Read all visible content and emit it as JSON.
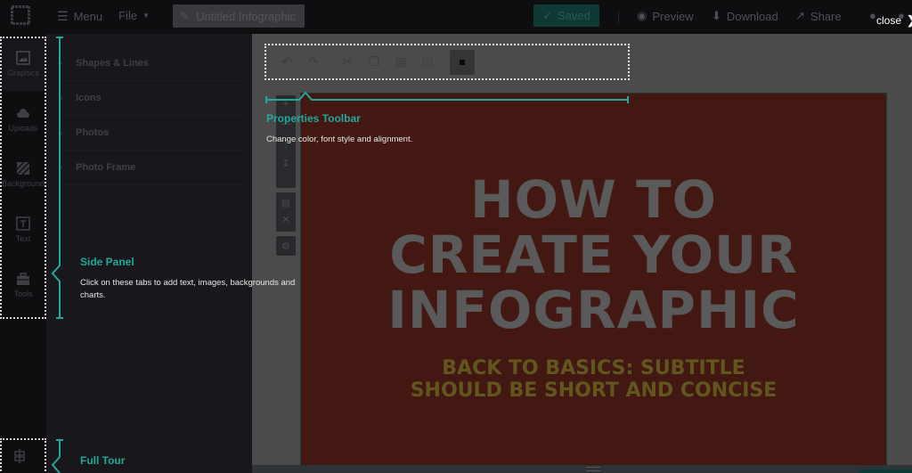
{
  "topbar": {
    "menu_label": "Menu",
    "file_label": "File",
    "document_title": "Untitled Infographic",
    "saved_label": "Saved",
    "preview_label": "Preview",
    "download_label": "Download",
    "share_label": "Share",
    "close_label": "close"
  },
  "rail": {
    "items": [
      {
        "label": "Graphics",
        "icon": "image-icon",
        "active": true
      },
      {
        "label": "Uploads",
        "icon": "cloud-upload-icon",
        "active": false
      },
      {
        "label": "Background",
        "icon": "background-pattern-icon",
        "active": false
      },
      {
        "label": "Text",
        "icon": "text-icon",
        "active": false
      },
      {
        "label": "Tools",
        "icon": "toolbox-icon",
        "active": false
      }
    ],
    "bottom_icon": "tour-signpost-icon"
  },
  "side_panel": {
    "items": [
      "Shapes & Lines",
      "Icons",
      "Photos",
      "Photo Frame"
    ]
  },
  "properties_toolbar": {
    "buttons": [
      "undo-icon",
      "redo-icon",
      "cut-icon",
      "copy-icon",
      "paste-icon",
      "delete-icon",
      "position-icon"
    ]
  },
  "vertical_toolbar": {
    "buttons": [
      "add-icon",
      "move-up-icon",
      "move-down-icon",
      "group-icon",
      "close-icon",
      "settings-icon"
    ]
  },
  "infographic": {
    "title_lines": [
      "HOW TO",
      "CREATE YOUR",
      "INFOGRAPHIC"
    ],
    "subtitle_lines": [
      "BACK TO BASICS: SUBTITLE",
      "SHOULD BE SHORT AND CONCISE"
    ],
    "background_color": "#431813",
    "title_color": "#5a5a5a",
    "subtitle_color": "#62561f"
  },
  "tour": {
    "accent_color": "#23a89b",
    "properties_toolbar": {
      "title": "Properties Toolbar",
      "text": "Change color, font style and alignment."
    },
    "side_panel": {
      "title": "Side Panel",
      "text": "Click on these tabs to add text, images, backgrounds and charts."
    },
    "full_tour": {
      "title": "Full Tour"
    }
  }
}
